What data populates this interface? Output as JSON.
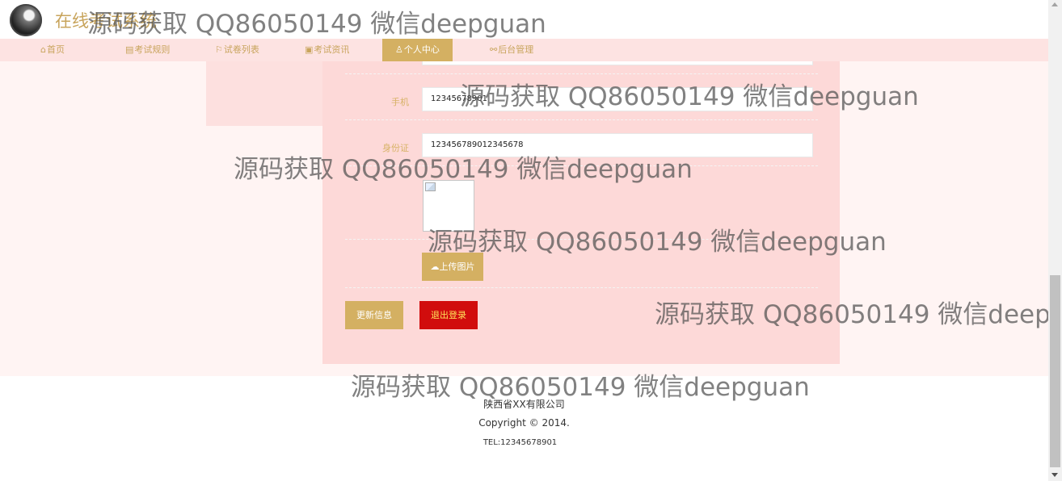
{
  "header": {
    "site_title": "在线考试系统"
  },
  "nav": {
    "items": [
      {
        "label": "首页",
        "icon": "home-icon",
        "glyph": "⌂"
      },
      {
        "label": "考试规则",
        "icon": "book-icon",
        "glyph": "▤"
      },
      {
        "label": "试卷列表",
        "icon": "flag-icon",
        "glyph": "⚐"
      },
      {
        "label": "考试资讯",
        "icon": "news-icon",
        "glyph": "▣"
      },
      {
        "label": "个人中心",
        "icon": "user-icon",
        "glyph": "♙",
        "active": true
      },
      {
        "label": "后台管理",
        "icon": "link-icon",
        "glyph": "⚯"
      }
    ]
  },
  "form": {
    "phone_label": "手机",
    "phone_value": "12345678901",
    "idcard_label": "身份证",
    "idcard_value": "123456789012345678",
    "upload_label": "上传图片",
    "update_label": "更新信息",
    "logout_label": "退出登录"
  },
  "footer": {
    "company": "陕西省XX有限公司",
    "copyright": "Copyright © 2014.",
    "tel": "TEL:12345678901"
  },
  "watermark": {
    "text": "源码获取 QQ86050149 微信deepguan"
  },
  "colors": {
    "accent": "#d4b062",
    "danger": "#d10d0d",
    "card": "#fdd9d8",
    "nav": "#fde3e2"
  }
}
